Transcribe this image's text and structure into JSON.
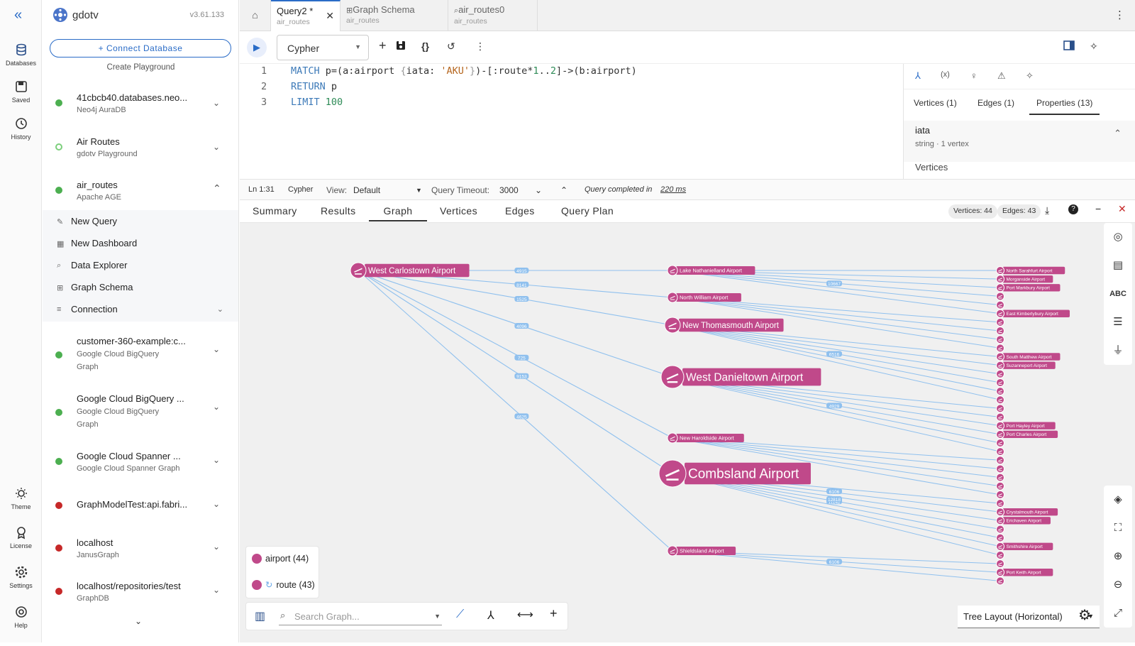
{
  "app": {
    "name": "gdotv",
    "version": "v3.61.133"
  },
  "rail": {
    "collapse_icon": "chevrons-left-icon",
    "items": [
      {
        "label": "Databases",
        "icon": "database-icon"
      },
      {
        "label": "Saved",
        "icon": "save-icon"
      },
      {
        "label": "History",
        "icon": "history-icon"
      }
    ],
    "bottom": [
      {
        "label": "Theme",
        "icon": "theme-icon"
      },
      {
        "label": "License",
        "icon": "license-icon"
      },
      {
        "label": "Settings",
        "icon": "gear-icon"
      },
      {
        "label": "Help",
        "icon": "help-icon"
      }
    ]
  },
  "sidebar": {
    "connect_label": "+ Connect Database",
    "playground_label": "Create Playground",
    "databases": [
      {
        "name": "41cbcb40.databases.neo...",
        "sub": "Neo4j AuraDB",
        "sub2": "",
        "status": "#4caf50"
      },
      {
        "name": "Air Routes",
        "sub": "gdotv Playground",
        "sub2": "",
        "status": "#7ccf7c"
      },
      {
        "name": "air_routes",
        "sub": "Apache AGE",
        "sub2": "",
        "status": "#4caf50"
      },
      {
        "name": "customer-360-example:c...",
        "sub": "Google Cloud BigQuery",
        "sub2": "Graph",
        "status": "#4caf50"
      },
      {
        "name": "Google Cloud BigQuery ...",
        "sub": "Google Cloud BigQuery",
        "sub2": "Graph",
        "status": "#4caf50"
      },
      {
        "name": "Google Cloud Spanner ...",
        "sub": "Google Cloud Spanner Graph",
        "sub2": "",
        "status": "#4caf50"
      },
      {
        "name": "GraphModelTest:api.fabri...",
        "sub": "",
        "sub2": "",
        "status": "#c62828"
      },
      {
        "name": "localhost",
        "sub": "JanusGraph",
        "sub2": "",
        "status": "#c62828"
      },
      {
        "name": "localhost/repositories/test",
        "sub": "GraphDB",
        "sub2": "",
        "status": "#c62828"
      }
    ],
    "air_routes_menu": [
      "New Query",
      "New Dashboard",
      "Data Explorer",
      "Graph Schema",
      "Connection"
    ]
  },
  "tabs": [
    {
      "title": "Query2 *",
      "sub": "air_routes"
    },
    {
      "title": "Graph Schema",
      "sub": "air_routes"
    },
    {
      "title": "air_routes0",
      "sub": "air_routes"
    }
  ],
  "toolbar": {
    "language": "Cypher"
  },
  "editor": {
    "lines": [
      "1",
      "2",
      "3"
    ]
  },
  "props": {
    "tabs": [
      "Vertices (1)",
      "Edges (1)",
      "Properties (13)"
    ],
    "property_name": "iata",
    "property_meta": "string · 1 vertex",
    "section": "Vertices"
  },
  "status": {
    "position": "Ln 1:31",
    "language": "Cypher",
    "view_label": "View:",
    "view_value": "Default",
    "timeout_label": "Query Timeout:",
    "timeout_value": "3000",
    "completed": "Query completed in",
    "duration": "220 ms"
  },
  "result_tabs": [
    "Summary",
    "Results",
    "Graph",
    "Vertices",
    "Edges",
    "Query Plan"
  ],
  "counts": {
    "vertices": "Vertices: 44",
    "edges": "Edges: 43"
  },
  "legend": [
    {
      "label": "airport (44)"
    },
    {
      "label": "route (43)"
    }
  ],
  "graph_search": {
    "placeholder": "Search Graph..."
  },
  "layout_select": "Tree Layout (Horizontal)",
  "graph": {
    "root": "West Carlostown Airport",
    "mid": [
      "Lake Nathanielland Airport",
      "North William Airport",
      "New Thomasmouth Airport",
      "West Danieltown Airport",
      "New Haroldside Airport",
      "Combsland Airport",
      "Shieldsland Airport"
    ],
    "leaf_labels": [
      "North Sarahfurt Airport",
      "Morganside Airport",
      "Port Markbury Airport",
      "East Kimberlybury Airport",
      "South Matthew Airport",
      "Suzanneport Airport",
      "Port Hayley Airport",
      "Port Charles Airport",
      "Crystalmouth Airport",
      "Erichaven Airport",
      "Smithshire Airport",
      "Port Keith Airport"
    ],
    "edge_labels": [
      "4915",
      "8141",
      "1525",
      "4096",
      "725",
      "9153",
      "4625",
      "10667",
      "6516",
      "4929",
      "11142",
      "10067",
      "6106",
      "12818"
    ]
  }
}
